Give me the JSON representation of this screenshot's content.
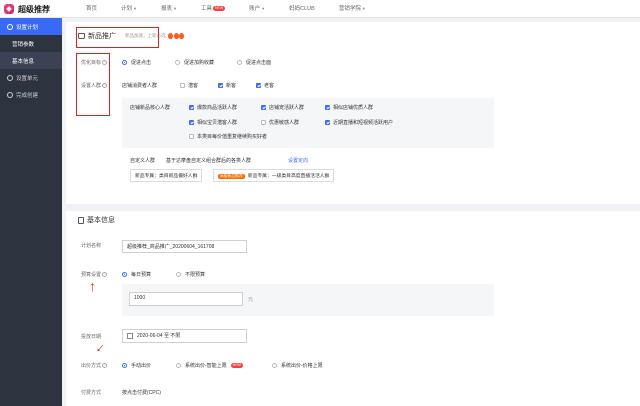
{
  "app": {
    "title": "超级推荐"
  },
  "nav": [
    {
      "label": "首页",
      "arrow": false
    },
    {
      "label": "计划",
      "arrow": true
    },
    {
      "label": "报表",
      "arrow": true
    },
    {
      "label": "工具",
      "arrow": false,
      "badge": "NEW"
    },
    {
      "label": "账户",
      "arrow": true
    },
    {
      "label": "妈妈CLUB",
      "arrow": false
    },
    {
      "label": "营销学院",
      "arrow": true
    }
  ],
  "sidebar": {
    "setup_plan": "设置计划",
    "marketing_params": "营销参数",
    "basic_info": "基本信息",
    "setup_unit": "设置单元",
    "done_create": "完成创建"
  },
  "promo": {
    "title": "新品推广",
    "subtitle": "新品加速，上新必选",
    "optimize_label": "优化目标",
    "optimize_options": [
      "促进点击",
      "促进加购收藏",
      "促进点击面"
    ],
    "crowd_label": "设置人群",
    "shop_consumer_label": "店铺消费者人群",
    "shop_consumer_options": [
      "潜客",
      "新客",
      "老客"
    ],
    "core_label": "店铺新品核心人群",
    "core_options": [
      "爆款商品活跃人群",
      "店铺宠活跃人群",
      "相似店铺优质人群",
      "相似宝贝潜客人群",
      "优惠敏感人群",
      "近期直播和短视频活跃用户",
      "本类目每价值重复继续购买好者"
    ],
    "custom_label": "自定义人群",
    "custom_desc": "基于达摩盘自定义组合群后的各类人群",
    "custom_link": "设置定向",
    "tag1": "新品专属：类目新品偏好人群",
    "tag2_badge": "高级新品推荐",
    "tag2": "新品专属：一级类目高度直播活活人群"
  },
  "basic": {
    "title": "基本信息",
    "plan_name_label": "计划名称",
    "plan_name_value": "超级推荐_商品推广_20200604_161708",
    "budget_label": "预算设置",
    "budget_options": [
      "每日预算",
      "不限预算"
    ],
    "budget_value": "1000",
    "budget_unit": "元",
    "date_label": "投放日期",
    "date_value": "2020-06-04 至 不限",
    "bid_label": "出价方式",
    "bid_options": [
      "手动出价",
      "系统出价-智能上限",
      "系统出价-价格上限"
    ],
    "bid_badge": "NEW",
    "pay_label": "付费方式",
    "pay_value": "按点击付费(CPC)"
  }
}
